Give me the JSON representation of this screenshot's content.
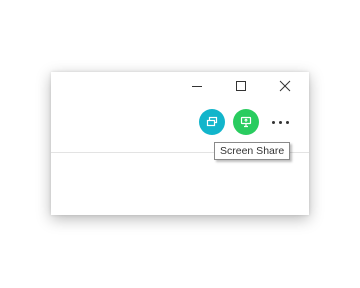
{
  "window": {
    "controls": {
      "minimize_icon": "minimize-icon",
      "maximize_icon": "maximize-icon",
      "close_icon": "close-icon"
    }
  },
  "toolbar": {
    "screens_button": {
      "icon": "screens-icon",
      "color": "#12b5cb"
    },
    "screen_share_button": {
      "icon": "screen-share-icon",
      "color": "#29cc5f"
    },
    "more_button": {
      "icon": "more-horizontal-icon"
    }
  },
  "tooltip": {
    "text": "Screen Share"
  }
}
